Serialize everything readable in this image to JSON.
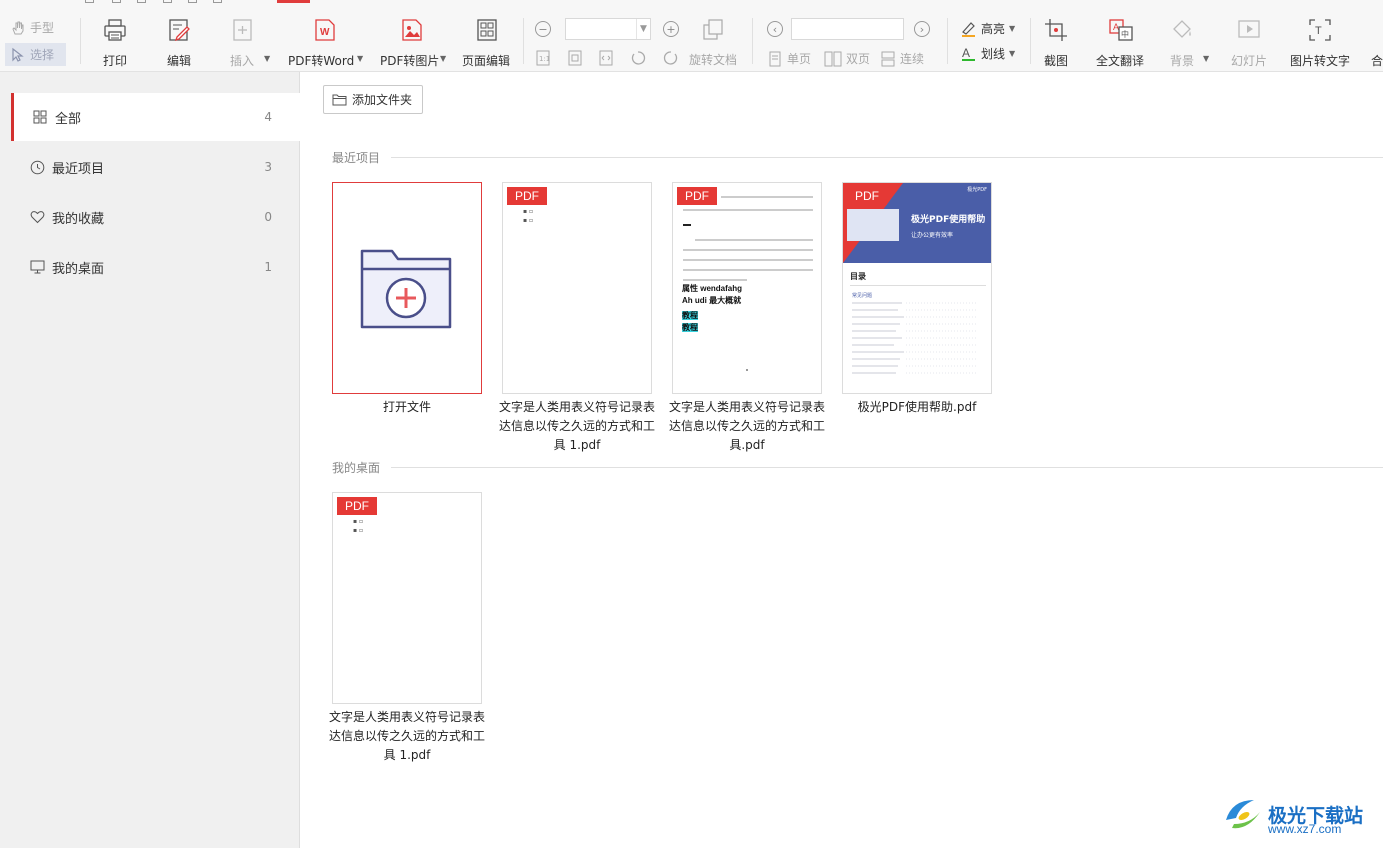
{
  "toolbar": {
    "hand_label": "手型",
    "select_label": "选择",
    "print_label": "打印",
    "edit_label": "编辑",
    "insert_label": "插入",
    "pdf_to_word_label": "PDF转Word",
    "pdf_to_image_label": "PDF转图片",
    "page_edit_label": "页面编辑",
    "rotate_label": "旋转文档",
    "single_page_label": "单页",
    "double_page_label": "双页",
    "continuous_label": "连续",
    "highlight_label": "高亮",
    "underline_label": "划线",
    "screenshot_label": "截图",
    "translate_label": "全文翻译",
    "background_label": "背景",
    "slideshow_label": "幻灯片",
    "image_to_text_label": "图片转文字",
    "merge_label": "合"
  },
  "sidebar": {
    "items": [
      {
        "label": "全部",
        "count": "4",
        "icon": "grid-icon"
      },
      {
        "label": "最近项目",
        "count": "3",
        "icon": "clock-icon"
      },
      {
        "label": "我的收藏",
        "count": "0",
        "icon": "heart-icon"
      },
      {
        "label": "我的桌面",
        "count": "1",
        "icon": "desktop-icon"
      }
    ]
  },
  "main": {
    "add_folder_label": "添加文件夹",
    "recent_section": "最近项目",
    "desktop_section": "我的桌面",
    "open_file_label": "打开文件",
    "badge": "PDF",
    "files": [
      {
        "name": "文字是人类用表义符号记录表达信息以传之久远的方式和工具 1.pdf"
      },
      {
        "name": "文字是人类用表义符号记录表达信息以传之久远的方式和工具.pdf"
      },
      {
        "name": "极光PDF使用帮助.pdf"
      }
    ],
    "desktop_files": [
      {
        "name": "文字是人类用表义符号记录表达信息以传之久远的方式和工具 1.pdf"
      }
    ]
  },
  "thumb": {
    "doc_heading1": "属性 wendafahg",
    "doc_heading2": "Ah udi 最大概就",
    "doc_hl1": "教程",
    "doc_hl2": "教程",
    "help_title": "极光PDF使用帮助",
    "help_subtitle": "让办公更有效率",
    "help_brand": "极光PDF",
    "help_toc": "目录",
    "help_section": "常见问题"
  },
  "watermark": {
    "text": "极光下载站",
    "url": "www.xz7.com"
  },
  "colors": {
    "accent": "#e03c3c",
    "badge": "#e53935",
    "help_banner": "#4a5ea8"
  }
}
